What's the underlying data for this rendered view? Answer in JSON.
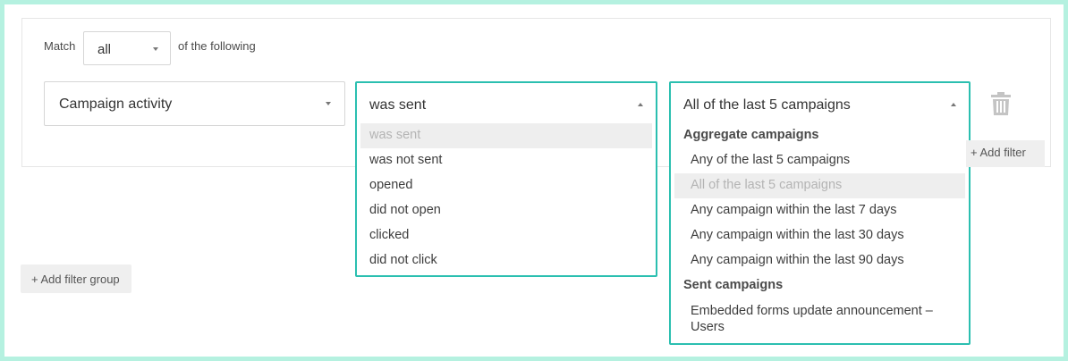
{
  "filter_group": {
    "match_label": "Match",
    "match_value": "all",
    "following_label": "of the following"
  },
  "condition": {
    "field_value": "Campaign activity",
    "operator": {
      "value": "was sent",
      "options": [
        "was sent",
        "was not sent",
        "opened",
        "did not open",
        "clicked",
        "did not click"
      ]
    },
    "scope": {
      "value": "All of the last 5 campaigns",
      "groups": [
        {
          "label": "Aggregate campaigns",
          "options": [
            "Any of the last 5 campaigns",
            "All of the last 5 campaigns",
            "Any campaign within the last 7 days",
            "Any campaign within the last 30 days",
            "Any campaign within the last 90 days"
          ]
        },
        {
          "label": "Sent campaigns",
          "options": [
            "Embedded forms update announcement – Users"
          ]
        }
      ]
    }
  },
  "buttons": {
    "add_filter": "+ Add filter",
    "add_filter_group": "+ Add filter group"
  },
  "colors": {
    "background": "#b5f1e0",
    "accent": "#2bbfb0",
    "highlight": "#eeeeee",
    "muted_text": "#b4b4b4"
  },
  "icons": {
    "delete": "trash-icon",
    "dropdown_closed": "caret-down-icon",
    "dropdown_open": "caret-up-icon"
  }
}
